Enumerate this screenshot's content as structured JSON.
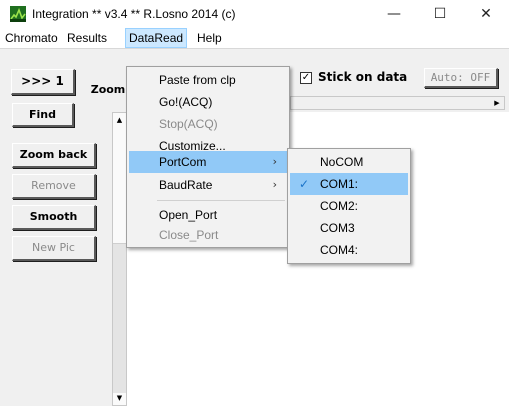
{
  "window": {
    "title": "Integration ** v3.4 ** R.Losno 2014 (c)",
    "minimize_glyph": "—",
    "maximize_glyph": "☐",
    "close_glyph": "✕"
  },
  "menubar": {
    "items": [
      "Chromato",
      "Results",
      "DataRead",
      "Help"
    ],
    "active": "DataRead"
  },
  "toolbar": {
    "btn_next": ">>> 1",
    "btn_zoom": "Zoom",
    "btn_find": "Find",
    "btn_zoom_back": "Zoom back",
    "btn_remove": "Remove",
    "btn_smooth": "Smooth",
    "btn_new_pic": "New Pic",
    "stick_label": "Stick on data",
    "stick_checked": true,
    "stick_check_glyph": "✓",
    "auto_label": "Auto: OFF",
    "scroll_up_glyph": "▲",
    "scroll_down_glyph": "▼",
    "scroll_right_glyph": "▶"
  },
  "dataread_menu": {
    "items": [
      {
        "label": "Paste from clp",
        "enabled": true
      },
      {
        "label": "Go!(ACQ)",
        "enabled": true
      },
      {
        "label": "Stop(ACQ)",
        "enabled": false
      },
      {
        "label": "Customize...",
        "enabled": true
      },
      {
        "label": "PortCom",
        "enabled": true,
        "submenu": true
      },
      {
        "label": "BaudRate",
        "enabled": true,
        "submenu": true
      },
      {
        "label": "Open_Port",
        "enabled": true
      },
      {
        "label": "Close_Port",
        "enabled": false
      }
    ],
    "submenu_glyph": "›"
  },
  "portcom_menu": {
    "items": [
      "NoCOM",
      "COM1:",
      "COM2:",
      "COM3",
      "COM4:"
    ],
    "selected": "COM1:",
    "check_glyph": "✓"
  },
  "colors": {
    "highlight": "#91c9f7",
    "menubar_active": "#cce8ff",
    "client_bg": "#f0f0f0",
    "icon_green": "#2e8b2e"
  }
}
